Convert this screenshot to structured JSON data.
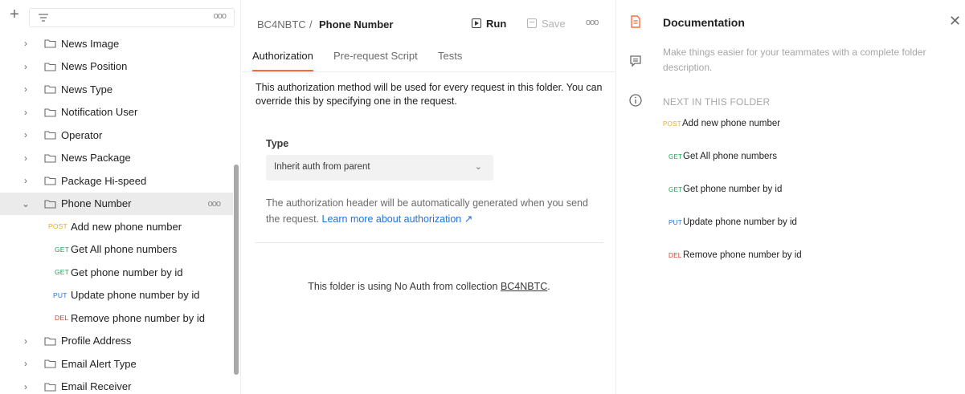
{
  "sidebar": {
    "add_icon": "plus-icon",
    "filter_icon": "filter-icon",
    "more_icon": "more-dots-icon",
    "folders_before": [
      "News Image",
      "News Position",
      "News Type",
      "Notification User",
      "Operator",
      "News Package",
      "Package Hi-speed"
    ],
    "selected_folder": "Phone Number",
    "requests": [
      {
        "method": "POST",
        "label": "Add new phone number"
      },
      {
        "method": "GET",
        "label": "Get All phone numbers"
      },
      {
        "method": "GET",
        "label": "Get phone number by id"
      },
      {
        "method": "PUT",
        "label": "Update phone number by id"
      },
      {
        "method": "DEL",
        "label": "Remove phone number by id"
      }
    ],
    "folders_after": [
      "Profile Address",
      "Email Alert Type",
      "Email Receiver"
    ]
  },
  "header": {
    "breadcrumb_parent": "BC4NBTC",
    "breadcrumb_sep": "/",
    "breadcrumb_current": "Phone Number",
    "run_label": "Run",
    "save_label": "Save"
  },
  "tabs": [
    "Authorization",
    "Pre-request Script",
    "Tests"
  ],
  "auth": {
    "description": "This authorization method will be used for every request in this folder. You can override this by specifying one in the request.",
    "type_label": "Type",
    "type_value": "Inherit auth from parent",
    "note_text": "The authorization header will be automatically generated when you send the request.",
    "note_link": "Learn more about authorization ↗",
    "noauth_text": "This folder is using No Auth from collection",
    "noauth_link": "BC4NBTC",
    "noauth_end": "."
  },
  "doc": {
    "title": "Documentation",
    "description": "Make things easier for your teammates with a complete folder description.",
    "next_header": "NEXT IN THIS FOLDER",
    "next_items": [
      {
        "method": "POST",
        "label": "Add new phone number"
      },
      {
        "method": "GET",
        "label": "Get All phone numbers"
      },
      {
        "method": "GET",
        "label": "Get phone number by id"
      },
      {
        "method": "PUT",
        "label": "Update phone number by id"
      },
      {
        "method": "DEL",
        "label": "Remove phone number by id"
      }
    ]
  },
  "colors": {
    "accent": "#ff6c37",
    "post": "#f2a71d",
    "get": "#1aa34f",
    "put": "#1e73d8",
    "del": "#e0362c"
  }
}
